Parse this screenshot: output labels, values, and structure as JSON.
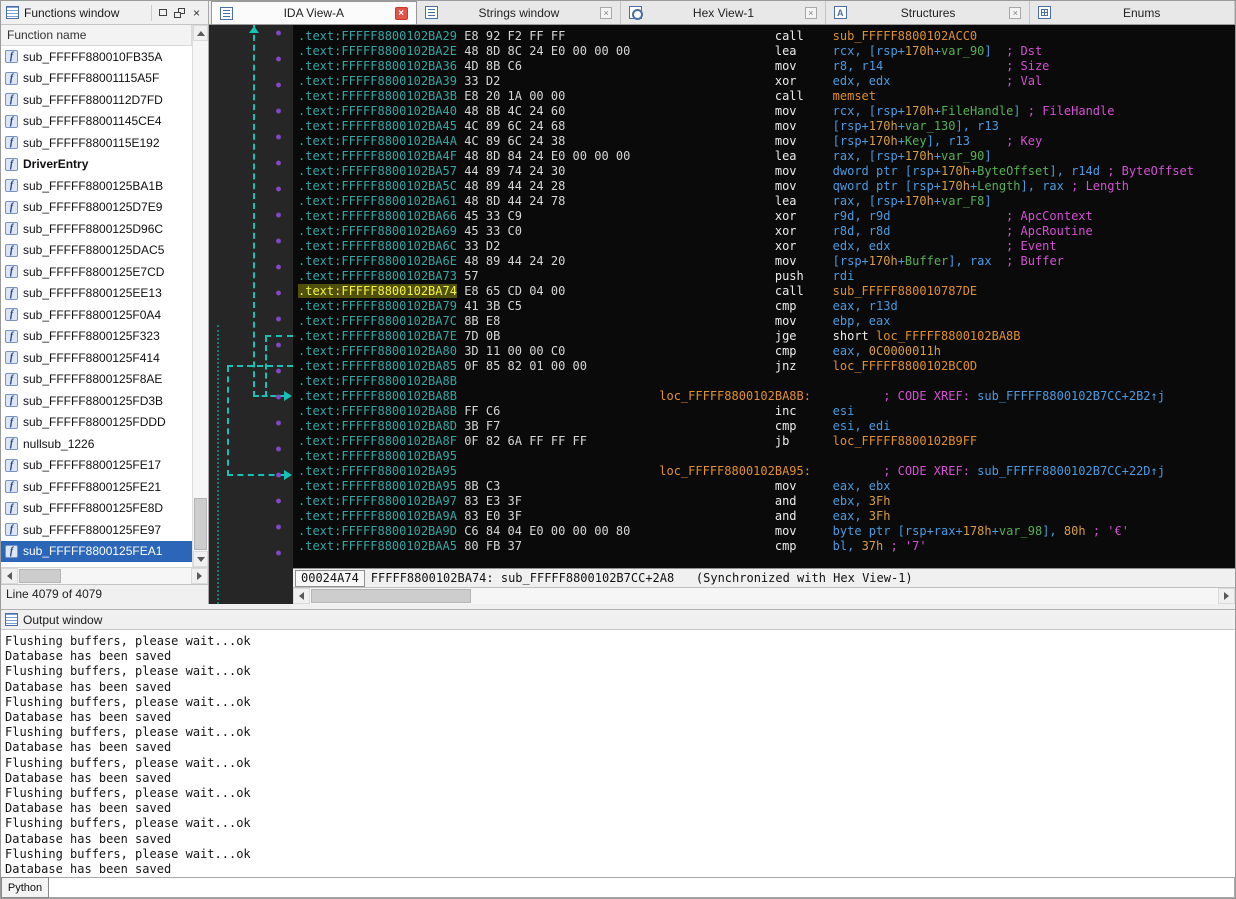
{
  "colors": {
    "selection_blue": "#2c66b8",
    "address_teal": "#35a5a5",
    "highlight_address_bg": "#50500a",
    "comment_magenta": "#d44fd4",
    "number_orange": "#d89d45",
    "name_orange": "#e08f2e",
    "register_blue": "#4a9ae0",
    "var_green": "#55b055",
    "arrow_teal": "#16c2b4",
    "dot_purple": "#8447c8",
    "close_red": "#e05548",
    "code_background": "#0a0a0a"
  },
  "functions_panel": {
    "title": "Functions window",
    "column_header": "Function name",
    "status": "Line 4079 of 4079",
    "bold_item": "DriverEntry",
    "selected_item": "sub_FFFFF8800125FEA1",
    "items": [
      "sub_FFFFF880010FB35A",
      "sub_FFFFF88001115A5F",
      "sub_FFFFF8800112D7FD",
      "sub_FFFFF88001145CE4",
      "sub_FFFFF8800115E192",
      "DriverEntry",
      "sub_FFFFF8800125BA1B",
      "sub_FFFFF8800125D7E9",
      "sub_FFFFF8800125D96C",
      "sub_FFFFF8800125DAC5",
      "sub_FFFFF8800125E7CD",
      "sub_FFFFF8800125EE13",
      "sub_FFFFF8800125F0A4",
      "sub_FFFFF8800125F323",
      "sub_FFFFF8800125F414",
      "sub_FFFFF8800125F8AE",
      "sub_FFFFF8800125FD3B",
      "sub_FFFFF8800125FDDD",
      "nullsub_1226",
      "sub_FFFFF8800125FE17",
      "sub_FFFFF8800125FE21",
      "sub_FFFFF8800125FE8D",
      "sub_FFFFF8800125FE97",
      "sub_FFFFF8800125FEA1"
    ]
  },
  "tabs": [
    {
      "label": "IDA View-A",
      "icon": "ida-view",
      "active": true,
      "closable": true
    },
    {
      "label": "Strings window",
      "icon": "strings",
      "active": false,
      "closable": true
    },
    {
      "label": "Hex View-1",
      "icon": "hex",
      "active": false,
      "closable": true
    },
    {
      "label": "Structures",
      "icon": "structures",
      "active": false,
      "closable": true
    },
    {
      "label": "Enums",
      "icon": "enums",
      "active": false,
      "closable": false
    }
  ],
  "disassembly": {
    "status_offset": "00024A74",
    "status_text": "FFFFF8800102BA74: sub_FFFFF8800102B7CC+2A8   (Synchronized with Hex View-1)",
    "xref_prefix": "; CODE XREF: ",
    "lines": [
      {
        "t": "code",
        "a": ".text:FFFFF8800102BA29",
        "b": "E8 92 F2 FF FF",
        "m": "call",
        "o": [
          [
            "f",
            "sub_FFFFF8800102ACC0"
          ]
        ]
      },
      {
        "t": "code",
        "a": ".text:FFFFF8800102BA2E",
        "b": "48 8D 8C 24 E0 00 00 00",
        "m": "lea",
        "o": [
          [
            "r",
            "rcx, [rsp+"
          ],
          [
            "n",
            "170h"
          ],
          [
            "r",
            "+"
          ],
          [
            "v",
            "var_90"
          ],
          [
            "r",
            "]"
          ]
        ],
        "c": "; Dst",
        "ct": true
      },
      {
        "t": "code",
        "a": ".text:FFFFF8800102BA36",
        "b": "4D 8B C6",
        "m": "mov",
        "o": [
          [
            "r",
            "r8, r14"
          ]
        ],
        "c": "; Size",
        "ct": true
      },
      {
        "t": "code",
        "a": ".text:FFFFF8800102BA39",
        "b": "33 D2",
        "m": "xor",
        "o": [
          [
            "r",
            "edx, edx"
          ]
        ],
        "c": "; Val",
        "ct": true
      },
      {
        "t": "code",
        "a": ".text:FFFFF8800102BA3B",
        "b": "E8 20 1A 00 00",
        "m": "call",
        "o": [
          [
            "f",
            "memset"
          ]
        ]
      },
      {
        "t": "code",
        "a": ".text:FFFFF8800102BA40",
        "b": "48 8B 4C 24 60",
        "m": "mov",
        "o": [
          [
            "r",
            "rcx, [rsp+"
          ],
          [
            "n",
            "170h"
          ],
          [
            "r",
            "+"
          ],
          [
            "v",
            "FileHandle"
          ],
          [
            "r",
            "]"
          ]
        ],
        "c": "; FileHandle",
        "ct": true
      },
      {
        "t": "code",
        "a": ".text:FFFFF8800102BA45",
        "b": "4C 89 6C 24 68",
        "m": "mov",
        "o": [
          [
            "r",
            "[rsp+"
          ],
          [
            "n",
            "170h"
          ],
          [
            "r",
            "+"
          ],
          [
            "v",
            "var_130"
          ],
          [
            "r",
            "], r13"
          ]
        ]
      },
      {
        "t": "code",
        "a": ".text:FFFFF8800102BA4A",
        "b": "4C 89 6C 24 38",
        "m": "mov",
        "o": [
          [
            "r",
            "[rsp+"
          ],
          [
            "n",
            "170h"
          ],
          [
            "r",
            "+"
          ],
          [
            "v",
            "Key"
          ],
          [
            "r",
            "], r13"
          ]
        ],
        "c": "; Key",
        "ct": true
      },
      {
        "t": "code",
        "a": ".text:FFFFF8800102BA4F",
        "b": "48 8D 84 24 E0 00 00 00",
        "m": "lea",
        "o": [
          [
            "r",
            "rax, [rsp+"
          ],
          [
            "n",
            "170h"
          ],
          [
            "r",
            "+"
          ],
          [
            "v",
            "var_90"
          ],
          [
            "r",
            "]"
          ]
        ]
      },
      {
        "t": "code",
        "a": ".text:FFFFF8800102BA57",
        "b": "44 89 74 24 30",
        "m": "mov",
        "o": [
          [
            "r",
            "dword ptr [rsp+"
          ],
          [
            "n",
            "170h"
          ],
          [
            "r",
            "+"
          ],
          [
            "v",
            "ByteOffset"
          ],
          [
            "r",
            "], r14d"
          ]
        ],
        "c": "; ByteOffset",
        "ct": true
      },
      {
        "t": "code",
        "a": ".text:FFFFF8800102BA5C",
        "b": "48 89 44 24 28",
        "m": "mov",
        "o": [
          [
            "r",
            "qword ptr [rsp+"
          ],
          [
            "n",
            "170h"
          ],
          [
            "r",
            "+"
          ],
          [
            "v",
            "Length"
          ],
          [
            "r",
            "], rax"
          ]
        ],
        "c": "; Length",
        "ct": true
      },
      {
        "t": "code",
        "a": ".text:FFFFF8800102BA61",
        "b": "48 8D 44 24 78",
        "m": "lea",
        "o": [
          [
            "r",
            "rax, [rsp+"
          ],
          [
            "n",
            "170h"
          ],
          [
            "r",
            "+"
          ],
          [
            "v",
            "var_F8"
          ],
          [
            "r",
            "]"
          ]
        ]
      },
      {
        "t": "code",
        "a": ".text:FFFFF8800102BA66",
        "b": "45 33 C9",
        "m": "xor",
        "o": [
          [
            "r",
            "r9d, r9d"
          ]
        ],
        "c": "; ApcContext",
        "ct": true
      },
      {
        "t": "code",
        "a": ".text:FFFFF8800102BA69",
        "b": "45 33 C0",
        "m": "xor",
        "o": [
          [
            "r",
            "r8d, r8d"
          ]
        ],
        "c": "; ApcRoutine",
        "ct": true
      },
      {
        "t": "code",
        "a": ".text:FFFFF8800102BA6C",
        "b": "33 D2",
        "m": "xor",
        "o": [
          [
            "r",
            "edx, edx"
          ]
        ],
        "c": "; Event",
        "ct": true
      },
      {
        "t": "code",
        "a": ".text:FFFFF8800102BA6E",
        "b": "48 89 44 24 20",
        "m": "mov",
        "o": [
          [
            "r",
            "[rsp+"
          ],
          [
            "n",
            "170h"
          ],
          [
            "r",
            "+"
          ],
          [
            "v",
            "Buffer"
          ],
          [
            "r",
            "], rax"
          ]
        ],
        "c": "; Buffer",
        "ct": true
      },
      {
        "t": "code",
        "a": ".text:FFFFF8800102BA73",
        "b": "57",
        "m": "push",
        "o": [
          [
            "r",
            "rdi"
          ]
        ]
      },
      {
        "t": "code",
        "a": ".text:FFFFF8800102BA74",
        "b": "E8 65 CD 04 00",
        "m": "call",
        "o": [
          [
            "f",
            "sub_FFFFF880010787DE"
          ]
        ],
        "hl": true
      },
      {
        "t": "code",
        "a": ".text:FFFFF8800102BA79",
        "b": "41 3B C5",
        "m": "cmp",
        "o": [
          [
            "r",
            "eax, r13d"
          ]
        ]
      },
      {
        "t": "code",
        "a": ".text:FFFFF8800102BA7C",
        "b": "8B E8",
        "m": "mov",
        "o": [
          [
            "r",
            "ebp, eax"
          ]
        ]
      },
      {
        "t": "code",
        "a": ".text:FFFFF8800102BA7E",
        "b": "7D 0B",
        "m": "jge",
        "o": [
          [
            "k",
            "short "
          ],
          [
            "f",
            "loc_FFFFF8800102BA8B"
          ]
        ]
      },
      {
        "t": "code",
        "a": ".text:FFFFF8800102BA80",
        "b": "3D 11 00 00 C0",
        "m": "cmp",
        "o": [
          [
            "r",
            "eax, "
          ],
          [
            "n",
            "0C0000011h"
          ]
        ]
      },
      {
        "t": "code",
        "a": ".text:FFFFF8800102BA85",
        "b": "0F 85 82 01 00 00",
        "m": "jnz",
        "o": [
          [
            "f",
            "loc_FFFFF8800102BC0D"
          ]
        ]
      },
      {
        "t": "blank",
        "a": ".text:FFFFF8800102BA8B"
      },
      {
        "t": "label",
        "a": ".text:FFFFF8800102BA8B",
        "l": "loc_FFFFF8800102BA8B:",
        "x": "sub_FFFFF8800102B7CC+2B2↑j"
      },
      {
        "t": "code",
        "a": ".text:FFFFF8800102BA8B",
        "b": "FF C6",
        "m": "inc",
        "o": [
          [
            "r",
            "esi"
          ]
        ]
      },
      {
        "t": "code",
        "a": ".text:FFFFF8800102BA8D",
        "b": "3B F7",
        "m": "cmp",
        "o": [
          [
            "r",
            "esi, edi"
          ]
        ]
      },
      {
        "t": "code",
        "a": ".text:FFFFF8800102BA8F",
        "b": "0F 82 6A FF FF FF",
        "m": "jb",
        "o": [
          [
            "f",
            "loc_FFFFF8800102B9FF"
          ]
        ]
      },
      {
        "t": "blank",
        "a": ".text:FFFFF8800102BA95"
      },
      {
        "t": "label",
        "a": ".text:FFFFF8800102BA95",
        "l": "loc_FFFFF8800102BA95:",
        "x": "sub_FFFFF8800102B7CC+22D↑j"
      },
      {
        "t": "code",
        "a": ".text:FFFFF8800102BA95",
        "b": "8B C3",
        "m": "mov",
        "o": [
          [
            "r",
            "eax, ebx"
          ]
        ]
      },
      {
        "t": "code",
        "a": ".text:FFFFF8800102BA97",
        "b": "83 E3 3F",
        "m": "and",
        "o": [
          [
            "r",
            "ebx, "
          ],
          [
            "n",
            "3Fh"
          ]
        ]
      },
      {
        "t": "code",
        "a": ".text:FFFFF8800102BA9A",
        "b": "83 E0 3F",
        "m": "and",
        "o": [
          [
            "r",
            "eax, "
          ],
          [
            "n",
            "3Fh"
          ]
        ]
      },
      {
        "t": "code",
        "a": ".text:FFFFF8800102BA9D",
        "b": "C6 84 04 E0 00 00 00 80",
        "m": "mov",
        "o": [
          [
            "r",
            "byte ptr [rsp+rax+"
          ],
          [
            "n",
            "178h"
          ],
          [
            "r",
            "+"
          ],
          [
            "v",
            "var_98"
          ],
          [
            "r",
            "], "
          ],
          [
            "n",
            "80h"
          ]
        ],
        "c": "; '€'",
        "ct": false
      },
      {
        "t": "code",
        "a": ".text:FFFFF8800102BAA5",
        "b": "80 FB 37",
        "m": "cmp",
        "o": [
          [
            "r",
            "bl, "
          ],
          [
            "n",
            "37h"
          ]
        ],
        "c": "; '7'",
        "ct": false
      }
    ]
  },
  "output_panel": {
    "title": "Output window",
    "lines": [
      "Flushing buffers, please wait...ok",
      "Database has been saved",
      "Flushing buffers, please wait...ok",
      "Database has been saved",
      "Flushing buffers, please wait...ok",
      "Database has been saved",
      "Flushing buffers, please wait...ok",
      "Database has been saved",
      "Flushing buffers, please wait...ok",
      "Database has been saved",
      "Flushing buffers, please wait...ok",
      "Database has been saved",
      "Flushing buffers, please wait...ok",
      "Database has been saved",
      "Flushing buffers, please wait...ok",
      "Database has been saved"
    ]
  },
  "python_label": "Python"
}
